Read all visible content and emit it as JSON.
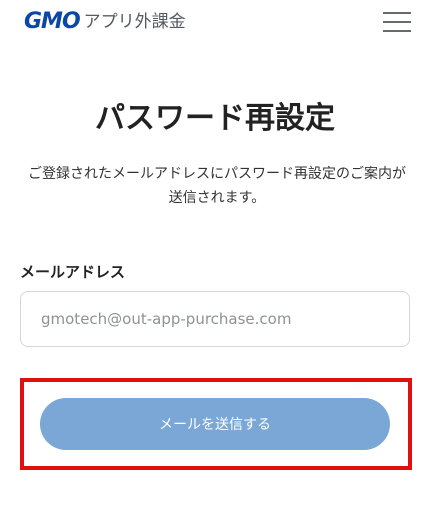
{
  "header": {
    "logo_brand": "GMO",
    "logo_subtitle": "アプリ外課金",
    "menu_icon": "hamburger-menu-icon"
  },
  "main": {
    "title": "パスワード再設定",
    "description": "ご登録されたメールアドレスにパスワード再設定のご案内が送信されます。",
    "email_label": "メールアドレス",
    "email_placeholder": "gmotech@out-app-purchase.com",
    "email_value": "",
    "submit_label": "メールを送信する"
  },
  "colors": {
    "brand_blue": "#0b47a8",
    "button_background": "#7ba7d6",
    "highlight_border": "#e01010"
  }
}
